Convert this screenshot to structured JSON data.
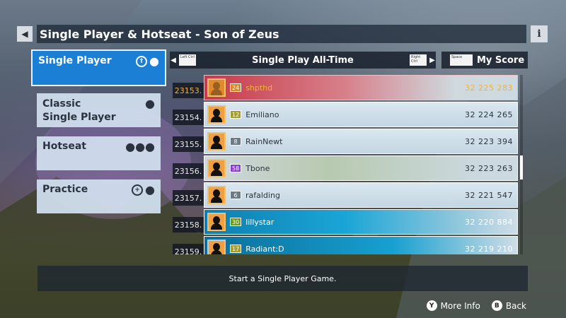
{
  "header": {
    "title": "Single Player & Hotseat - Son of Zeus",
    "back_icon": "◀",
    "info_icon": "i"
  },
  "menu": {
    "items": [
      {
        "label": "Single Player",
        "active": true
      },
      {
        "label": "Classic Single Player",
        "line1": "Classic",
        "line2": "Single Player"
      },
      {
        "label": "Hotseat"
      },
      {
        "label": "Practice"
      }
    ]
  },
  "leaderboard": {
    "title": "Single Play All-Time",
    "left_key": "Left Ctrl",
    "right_key": "Right Ctrl",
    "myscore_key": "Space",
    "myscore_label": "My Score",
    "rows": [
      {
        "rank": "23153.",
        "level": "24",
        "name": "shpthd",
        "score": "32 225 283"
      },
      {
        "rank": "23154.",
        "level": "12",
        "name": "Emiliano",
        "score": "32 224 265"
      },
      {
        "rank": "23155.",
        "level": "8",
        "name": "RainNewt",
        "score": "32 223 394"
      },
      {
        "rank": "23156.",
        "level": "58",
        "name": "Tbone",
        "score": "32 223 263"
      },
      {
        "rank": "23157.",
        "level": "6",
        "name": "rafalding",
        "score": "32 221 547"
      },
      {
        "rank": "23158.",
        "level": "30",
        "name": "lillystar",
        "score": "32 220 884"
      },
      {
        "rank": "23159.",
        "level": "17",
        "name": "Radiant:D",
        "score": "32 219 210"
      }
    ]
  },
  "status_text": "Start a Single Player Game.",
  "hints": {
    "more_info_key": "Y",
    "more_info_label": "More Info",
    "back_key": "B",
    "back_label": "Back"
  },
  "colors": {
    "active_menu": "#1b7fd6",
    "highlight_text": "#f1b23a"
  }
}
